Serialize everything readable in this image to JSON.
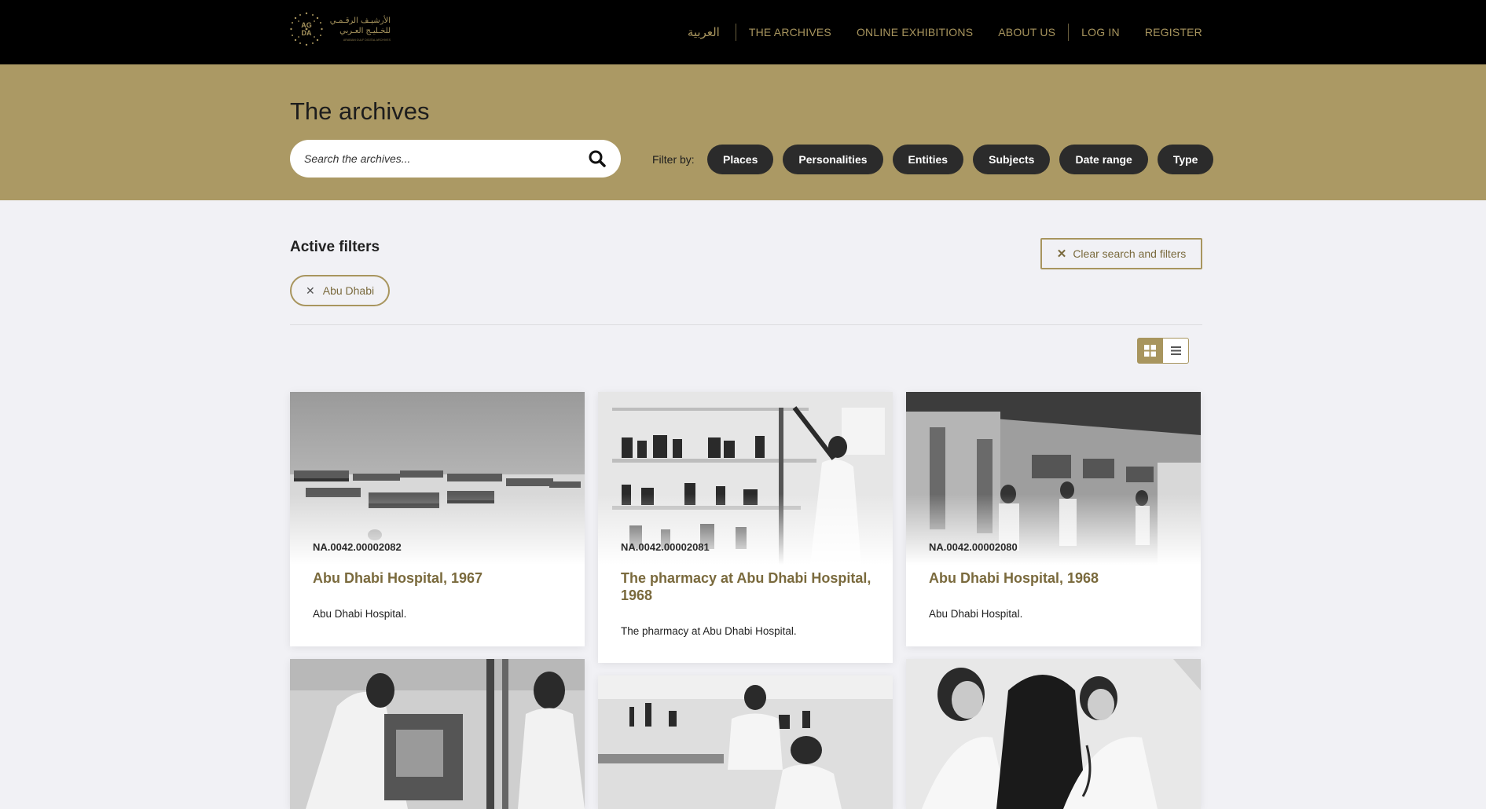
{
  "header": {
    "logo_text_ar_line1": "الأرشيـف الرقـمـي",
    "logo_text_ar_line2": "للخـليـج العـربي",
    "logo_initials": "AG DA",
    "logo_text_en": "ARABIAN GULF DIGITAL ARCHIVES",
    "nav": {
      "arabic": "العربية",
      "archives": "THE ARCHIVES",
      "exhibitions": "ONLINE EXHIBITIONS",
      "about": "ABOUT US",
      "login": "LOG IN",
      "register": "REGISTER"
    }
  },
  "hero": {
    "title": "The archives",
    "search_placeholder": "Search the archives...",
    "filter_label": "Filter by:",
    "filters": [
      "Places",
      "Personalities",
      "Entities",
      "Subjects",
      "Date range",
      "Type"
    ]
  },
  "active_filters": {
    "title": "Active filters",
    "clear_label": "Clear search and filters",
    "tags": [
      "Abu Dhabi"
    ]
  },
  "results": [
    {
      "code": "NA.0042.00002082",
      "title": "Abu Dhabi Hospital, 1967",
      "desc": "Abu Dhabi Hospital."
    },
    {
      "code": "NA.0042.00002081",
      "title": "The pharmacy at Abu Dhabi Hospital, 1968",
      "desc": "The pharmacy at Abu Dhabi Hospital."
    },
    {
      "code": "NA.0042.00002080",
      "title": "Abu Dhabi Hospital, 1968",
      "desc": "Abu Dhabi Hospital."
    }
  ],
  "colors": {
    "gold": "#ab9964",
    "gold_text": "#7a6a3d",
    "dark_chip": "#2b2b2b",
    "page_bg": "#f1f1f5"
  },
  "icons": {
    "search": "search-icon",
    "clear": "close-icon",
    "grid_view": "grid-icon",
    "list_view": "list-icon"
  }
}
